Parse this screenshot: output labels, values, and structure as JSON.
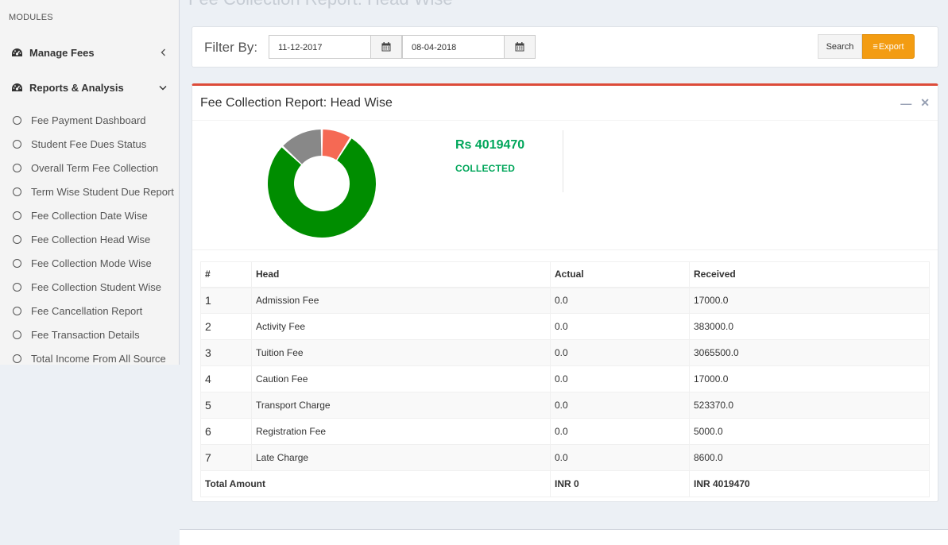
{
  "page": {
    "title": "Fee Collection Report: Head Wise"
  },
  "sidebar": {
    "header": "MODULES",
    "menus": [
      {
        "label": "Manage Fees",
        "icon": "dashboard-icon",
        "chevron": "chevron-left-icon"
      },
      {
        "label": "Reports & Analysis",
        "icon": "dashboard-icon",
        "chevron": "chevron-down-icon"
      }
    ],
    "sub_items": [
      {
        "label": "Fee Payment Dashboard"
      },
      {
        "label": "Student Fee Dues Status"
      },
      {
        "label": "Overall Term Fee Collection"
      },
      {
        "label": "Term Wise Student Due Report"
      },
      {
        "label": "Fee Collection Date Wise"
      },
      {
        "label": "Fee Collection Head Wise"
      },
      {
        "label": "Fee Collection Mode Wise"
      },
      {
        "label": "Fee Collection Student Wise"
      },
      {
        "label": "Fee Cancellation Report"
      },
      {
        "label": "Fee Transaction Details"
      },
      {
        "label": "Total Income From All Source"
      }
    ]
  },
  "filter": {
    "label": "Filter By:",
    "from_date": "11-12-2017",
    "to_date": "08-04-2018",
    "search_label": "Search",
    "export_label": "Export",
    "export_color": "#f39c12"
  },
  "report": {
    "title": "Fee Collection Report: Head Wise",
    "accent_color": "#dd4b39",
    "minimize_icon": "minus-icon",
    "close_icon": "times-icon",
    "collected_amount": "Rs 4019470",
    "collected_label": "COLLECTED",
    "collected_color": "#00a65a"
  },
  "chart_data": {
    "type": "pie",
    "donut": true,
    "series": [
      {
        "value": 0.09,
        "color": "#f56954"
      },
      {
        "value": 0.78,
        "color": "#008d00"
      },
      {
        "value": 0.13,
        "color": "#888888"
      }
    ]
  },
  "table": {
    "headers": [
      "#",
      "Head",
      "Actual",
      "Received"
    ],
    "rows": [
      [
        "1",
        "Admission Fee",
        "0.0",
        "17000.0"
      ],
      [
        "2",
        "Activity Fee",
        "0.0",
        "383000.0"
      ],
      [
        "3",
        "Tuition Fee",
        "0.0",
        "3065500.0"
      ],
      [
        "4",
        "Caution Fee",
        "0.0",
        "17000.0"
      ],
      [
        "5",
        "Transport Charge",
        "0.0",
        "523370.0"
      ],
      [
        "6",
        "Registration Fee",
        "0.0",
        "5000.0"
      ],
      [
        "7",
        "Late Charge",
        "0.0",
        "8600.0"
      ]
    ],
    "footer": [
      "Total Amount",
      "INR 0",
      "INR 4019470"
    ]
  }
}
